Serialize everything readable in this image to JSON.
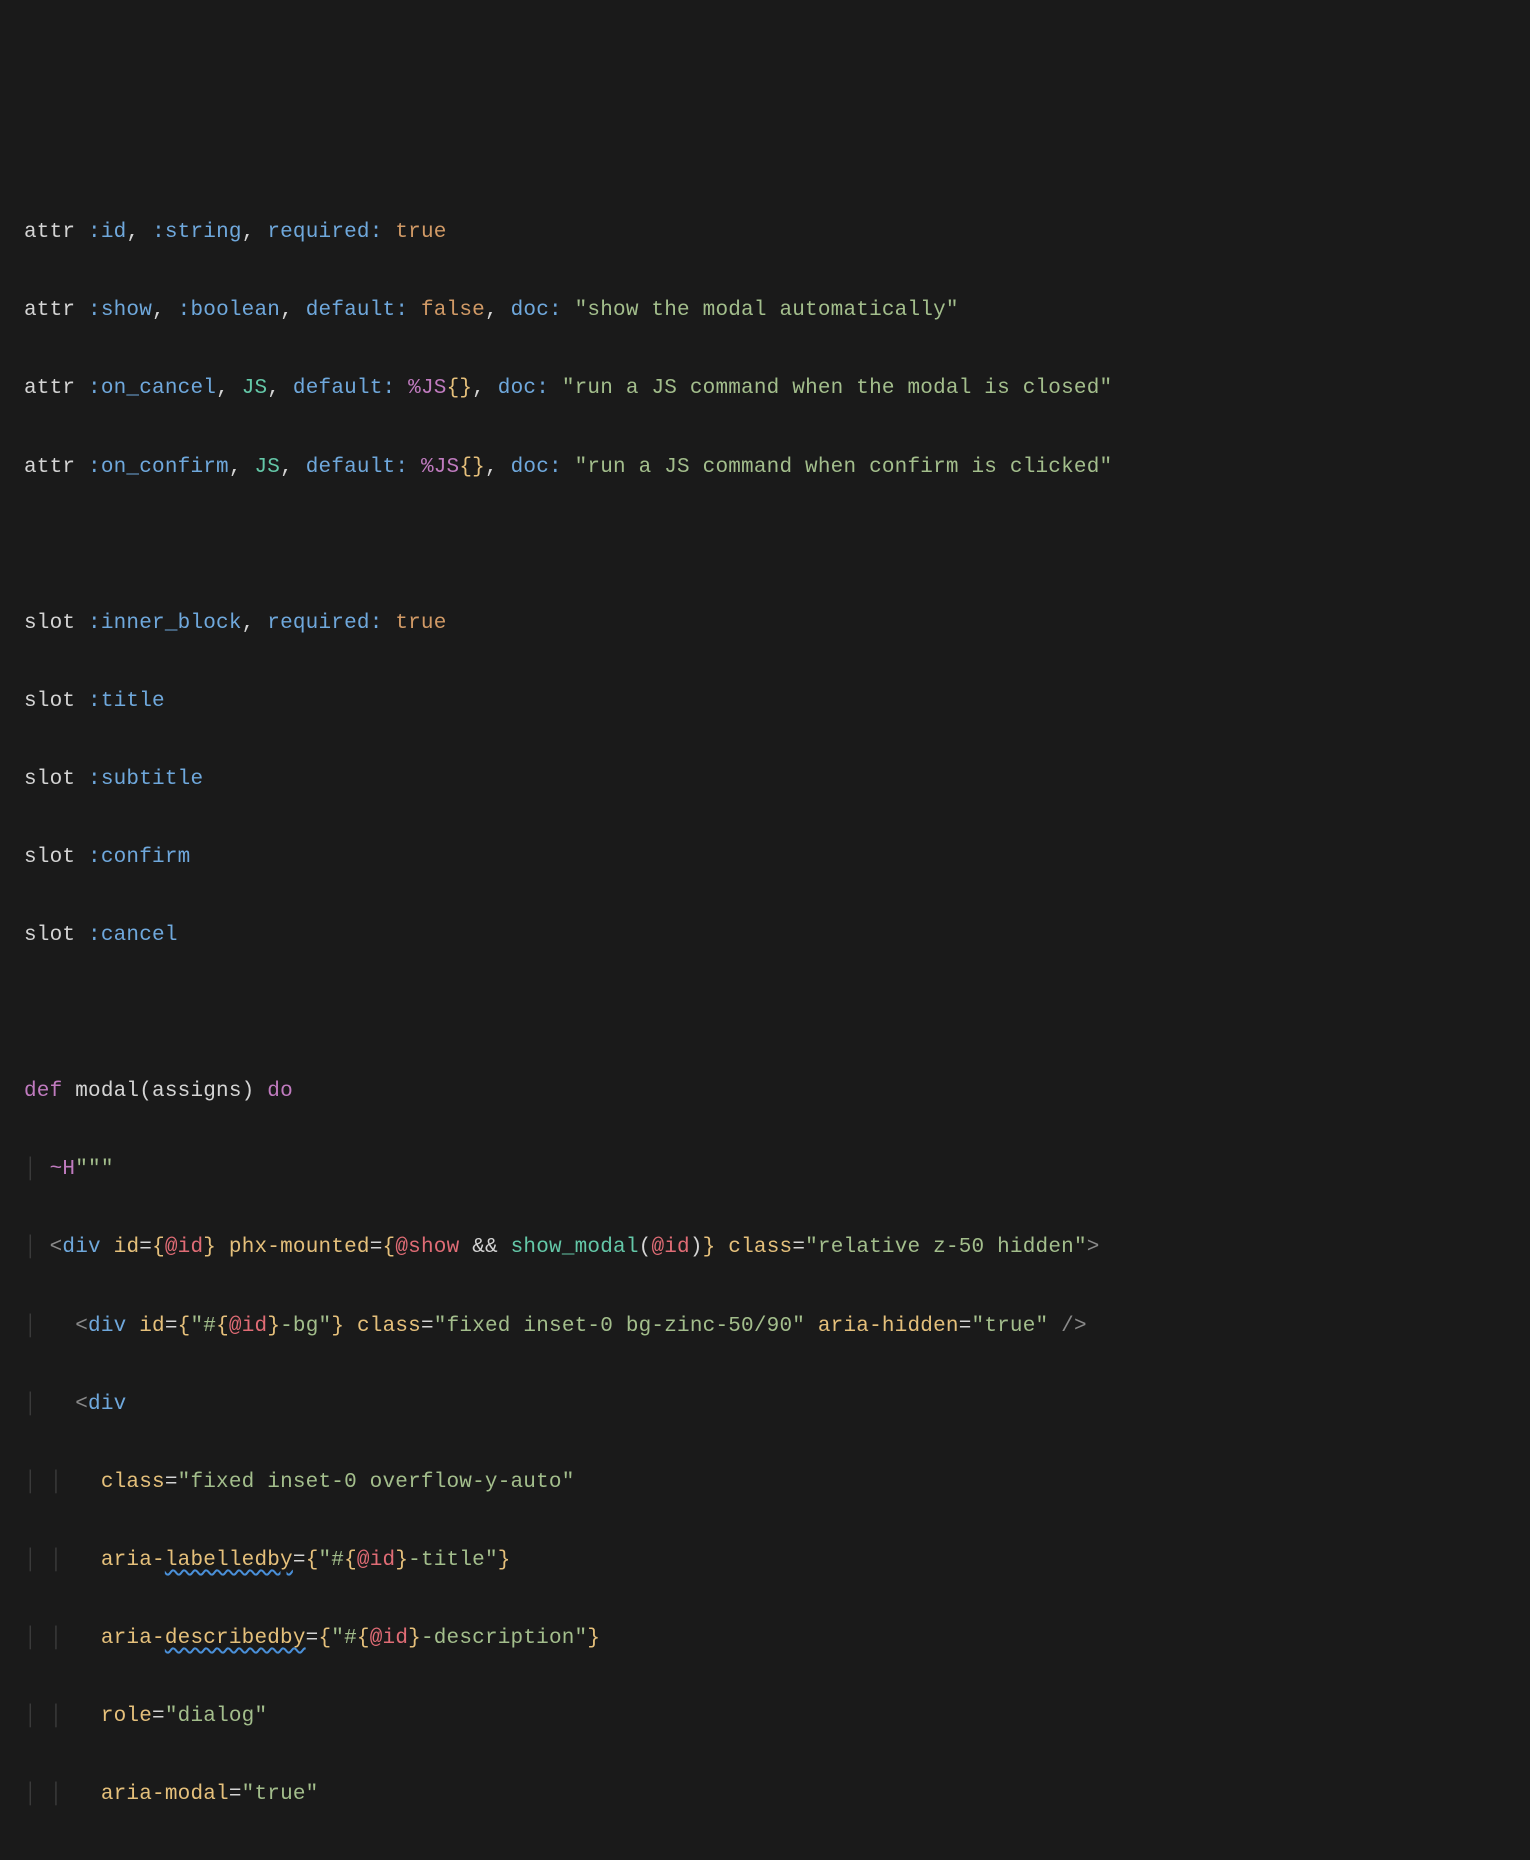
{
  "lines": {
    "l1": {
      "kw": "attr",
      "a1": ":id",
      "a2": ":string",
      "k1": "required:",
      "v1": "true"
    },
    "l2": {
      "kw": "attr",
      "a1": ":show",
      "a2": ":boolean",
      "k1": "default:",
      "v1": "false",
      "k2": "doc:",
      "s1": "\"show the modal automatically\""
    },
    "l3": {
      "kw": "attr",
      "a1": ":on_cancel",
      "t1": "JS",
      "k1": "default:",
      "pct": "%JS",
      "br": "{}",
      "k2": "doc:",
      "s1": "\"run a JS command when the modal is closed\""
    },
    "l4": {
      "kw": "attr",
      "a1": ":on_confirm",
      "t1": "JS",
      "k1": "default:",
      "pct": "%JS",
      "br": "{}",
      "k2": "doc:",
      "s1": "\"run a JS command when confirm is clicked\""
    },
    "l6": {
      "kw": "slot",
      "a1": ":inner_block",
      "k1": "required:",
      "v1": "true"
    },
    "l7": {
      "kw": "slot",
      "a1": ":title"
    },
    "l8": {
      "kw": "slot",
      "a1": ":subtitle"
    },
    "l9": {
      "kw": "slot",
      "a1": ":confirm"
    },
    "l10": {
      "kw": "slot",
      "a1": ":cancel"
    },
    "l12": {
      "def": "def",
      "fn": "modal",
      "lp": "(",
      "param": "assigns",
      "rp": ")",
      "do": "do"
    },
    "l13": {
      "sigil": "~H",
      "q": "\"\"\""
    },
    "l14": {
      "open": "<",
      "tag": "div",
      "a_id": "id",
      "eq": "=",
      "lb": "{",
      "at_id": "@id",
      "rb": "}",
      "a_phx": "phx-mounted",
      "lb2": "{",
      "at_show": "@show",
      "amp": "&&",
      "fn_sm": "show_modal",
      "lp": "(",
      "at_id2": "@id",
      "rp": ")",
      "rb2": "}",
      "a_class": "class",
      "s_class": "\"relative z-50 hidden\"",
      "close": ">"
    },
    "l15": {
      "open": "<",
      "tag": "div",
      "a_id": "id",
      "eq": "=",
      "lb": "{",
      "s_pre": "\"#",
      "il": "{",
      "at_id": "@id",
      "ir": "}",
      "s_post": "-bg\"",
      "rb": "}",
      "a_class": "class",
      "s_class": "\"fixed inset-0 bg-zinc-50/90\"",
      "a_ah": "aria-hidden",
      "s_ah": "\"true\"",
      "close": "/>"
    },
    "l16": {
      "open": "<",
      "tag": "div"
    },
    "l17": {
      "a_class": "class",
      "s_class": "\"fixed inset-0 overflow-y-auto\""
    },
    "l18": {
      "a_lbl_pre": "aria-",
      "a_lbl_wavy": "labelledby",
      "eq": "=",
      "lb": "{",
      "s_pre": "\"#",
      "il": "{",
      "at_id": "@id",
      "ir": "}",
      "s_post": "-title\"",
      "rb": "}"
    },
    "l19": {
      "a_desc_pre": "aria-",
      "a_desc_wavy": "describedby",
      "eq": "=",
      "lb": "{",
      "s_pre": "\"#",
      "il": "{",
      "at_id": "@id",
      "ir": "}",
      "s_post": "-description\"",
      "rb": "}"
    },
    "l20": {
      "a_role": "role",
      "s_role": "\"dialog\""
    },
    "l21": {
      "a_am": "aria-modal",
      "s_am": "\"true\""
    }
  },
  "guides": {
    "g1": "│ ",
    "g2": "│ │ ",
    "sp2": "  ",
    "sp4": "    ",
    "sp6": "      "
  }
}
